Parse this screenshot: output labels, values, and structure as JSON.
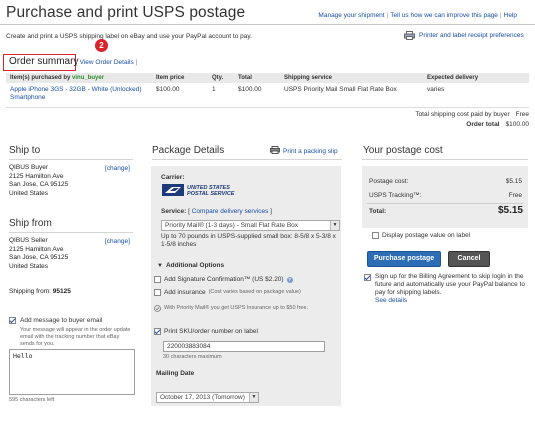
{
  "header": {
    "title": "Purchase and print USPS postage",
    "links": [
      "Manage your shipment",
      "Tell us how we can improve this page",
      "Help"
    ]
  },
  "intro": "Create and print a USPS shipping label on eBay and use your PayPal account to pay.",
  "pref_link": "Printer and label receipt preferences",
  "order_summary": {
    "title": "Order summary",
    "badge": "2",
    "view_details": "View Order Details",
    "bracket_open": "[",
    "bracket_close": "]",
    "columns": [
      "Item(s) purchased by",
      "Item price",
      "Qty.",
      "Total",
      "Shipping service",
      "Expected delivery"
    ],
    "buyer": "vinu_buyer",
    "row": {
      "item": "Apple iPhone 3GS - 32GB - White (Unlocked) Smartphone",
      "price": "$100.00",
      "qty": "1",
      "total": "$100.00",
      "service": "USPS Priority Mail Small Flat Rate Box",
      "delivery": "varies"
    },
    "shipping_cost_label": "Total shipping cost paid by buyer",
    "shipping_cost_value": "Free",
    "order_total_label": "Order total",
    "order_total_value": "$100.00"
  },
  "ship_to": {
    "title": "Ship to",
    "change": "[change]",
    "lines": [
      "QIBUS Buyer",
      "2125 Hamilton Ave",
      "San Jose, CA 95125",
      "United States"
    ]
  },
  "ship_from": {
    "title": "Ship from",
    "change": "[change]",
    "lines": [
      "QIBUS Seller",
      "2125 Hamilton Ave",
      "San Jose, CA 95125",
      "United States"
    ],
    "zip_label": "Shipping from:",
    "zip_value": "95125"
  },
  "message": {
    "checkbox_label": "Add message to buyer email",
    "help": "Your message will appear in the order update email with the tracking number that eBay sends for you.",
    "value": "Hello",
    "chars_left": "595 characters left"
  },
  "package": {
    "title": "Package Details",
    "packing_slip": "Print a packing slip",
    "carrier_label": "Carrier:",
    "usps_line1": "UNITED STATES",
    "usps_line2": "POSTAL SERVICE",
    "service_label": "Service:",
    "service_bracket_open": "[",
    "service_bracket_close": "]",
    "compare_link": "Compare delivery services",
    "service_value": "Priority Mail® (1-3 days) - Small Flat Rate Box",
    "service_note": "Up to 70 pounds in USPS-supplied small box: 8-5/8 x 5-3/8 x 1-5/8 inches",
    "options_title": "Additional Options",
    "signature_label": "Add Signature Confirmation™ (US $2.20)",
    "insurance_label": "Add insurance",
    "insurance_note": "(Cost varies based on package value)",
    "insurance_help": "With Priority Mail® you get USPS Insurance up to $50 free.",
    "sku_label": "Print SKU/order number on label",
    "sku_value": "220003883084",
    "sku_hint": "30 characters maximum",
    "mailing_date_label": "Mailing Date",
    "mailing_date_value": "October 17, 2013 (Tomorrow)"
  },
  "postage": {
    "title": "Your postage cost",
    "rows": [
      {
        "label": "Postage cost:",
        "value": "$5.15"
      },
      {
        "label": "USPS Tracking™:",
        "value": "Free"
      }
    ],
    "total_label": "Total:",
    "total_value": "$5.15",
    "display_value_label": "Display postage value on label",
    "billing_text": "Sign up for the Billing Agreement to skip login in the future and automatically use your PayPal balance to pay for shipping labels.",
    "see_details": "See details",
    "purchase_button": "Purchase postage",
    "cancel_button": "Cancel"
  },
  "colors": {
    "link": "#1a4ea6",
    "highlight": "#d9232d",
    "primary_button": "#2d6db5",
    "panel_bg": "#ececec"
  }
}
